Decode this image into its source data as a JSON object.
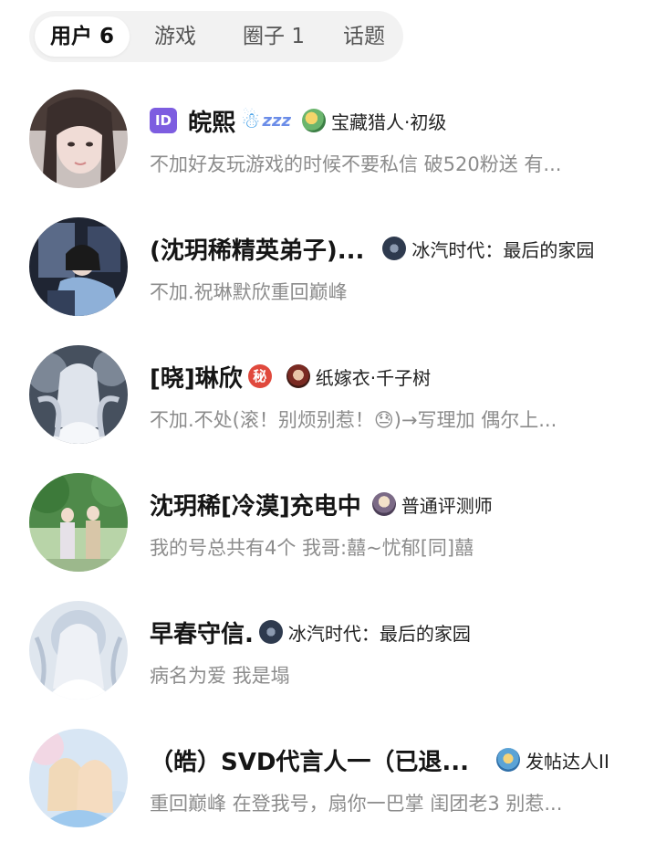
{
  "tabs": [
    {
      "label": "用户 6",
      "active": true
    },
    {
      "label": "游戏",
      "active": false
    },
    {
      "label": "圈子 1",
      "active": false
    },
    {
      "label": "话题",
      "active": false
    }
  ],
  "users": [
    {
      "id_badge": "ID",
      "name": "皖熙",
      "name_icons": [
        "snowman-icon",
        "sleep-zzz-icon"
      ],
      "badge_icon": "treasure-hunter-icon",
      "badge_text": "宝藏猎人·初级",
      "desc": "不加好友玩游戏的时候不要私信 破520粉送 有..."
    },
    {
      "name": "(沈玥稀精英弟子)...",
      "badge_icon": "game-icon",
      "badge_text": "冰汽时代：最后的家园",
      "desc": "不加.祝琳默欣重回巅峰"
    },
    {
      "name": "[晓]琳欣",
      "secret_badge": "秘",
      "badge_icon": "game-icon",
      "badge_text": "纸嫁衣·千子树",
      "desc": "不加.不处(滚！别烦别惹！😓)→写理加 偶尔上..."
    },
    {
      "name": "沈玥稀[冷漠]充电中",
      "badge_icon": "reviewer-icon",
      "badge_text": "普通评测师",
      "desc": "我的号总共有4个 我哥:囍~忧郁[同]囍"
    },
    {
      "name": "早春守信.",
      "badge_icon": "game-icon",
      "badge_text": "冰汽时代：最后的家园",
      "desc": "病名为爱 我是塌"
    },
    {
      "name": "（皓）SVD代言人一（已退...",
      "badge_icon": "poster-icon",
      "badge_text": "发帖达人II",
      "desc": "重回巅峰 在登我号，扇你一巴掌 闺团老3 别惹..."
    }
  ]
}
